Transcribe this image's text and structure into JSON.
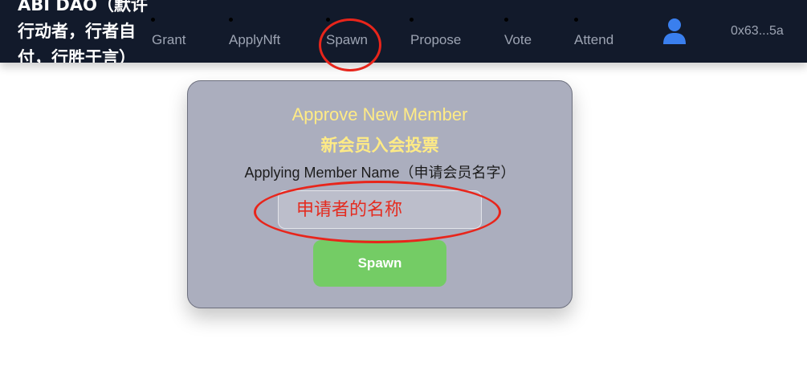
{
  "navbar": {
    "brand": "ABI DAO（默许行动者，行者自付，行胜于言）",
    "items": [
      {
        "label": "Grant"
      },
      {
        "label": "ApplyNft"
      },
      {
        "label": "Spawn"
      },
      {
        "label": "Propose"
      },
      {
        "label": "Vote"
      },
      {
        "label": "Attend"
      }
    ],
    "user_icon": "user-icon",
    "wallet": "0x63...5a"
  },
  "card": {
    "title_en": "Approve New Member",
    "title_zh": "新会员入会投票",
    "label": "Applying Member Name（申请会员名字）",
    "input_placeholder": "申请者的名称",
    "button_label": "Spawn"
  },
  "colors": {
    "navbar_bg": "#121a2b",
    "nav_text": "#9da4b3",
    "card_bg": "#abaebe",
    "title_yellow": "#ffeb85",
    "button_green": "#74cc65",
    "annotation_red": "#e8251b",
    "user_icon_blue": "#3a7fee"
  }
}
